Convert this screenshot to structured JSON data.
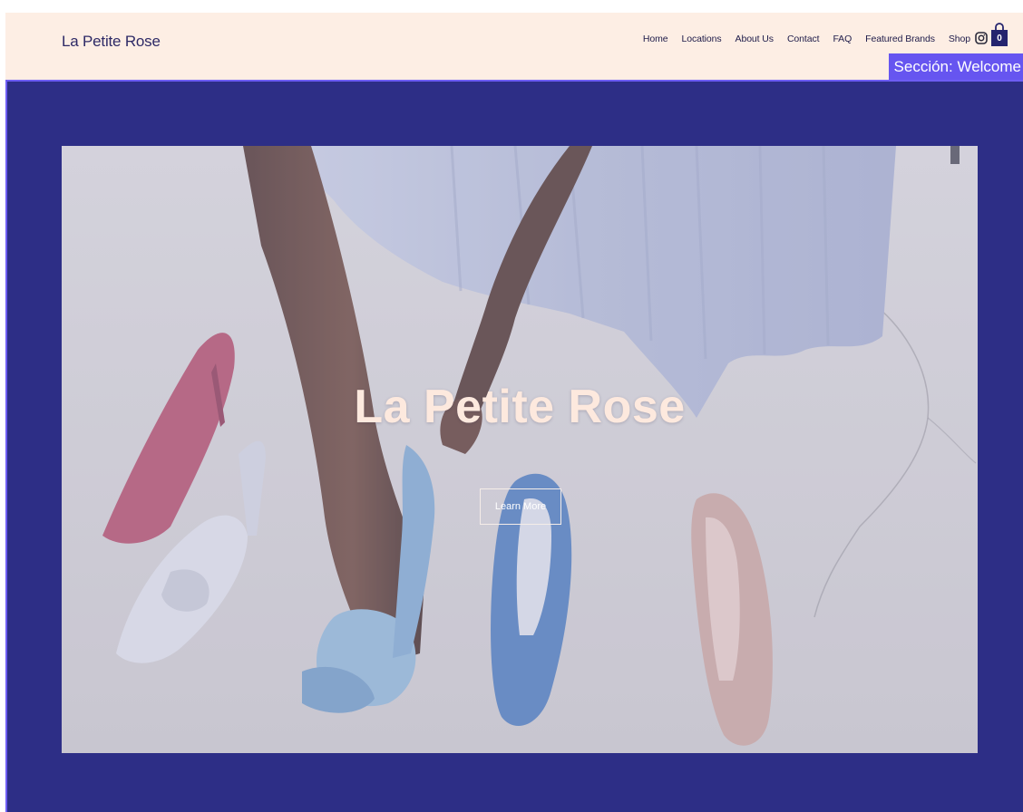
{
  "header": {
    "logo": "La Petite Rose",
    "nav": [
      {
        "label": "Home"
      },
      {
        "label": "Locations"
      },
      {
        "label": "About Us"
      },
      {
        "label": "Contact"
      },
      {
        "label": "FAQ"
      },
      {
        "label": "Featured Brands"
      },
      {
        "label": "Shop"
      }
    ],
    "cart_count": "0",
    "icons": [
      "instagram-icon",
      "shopping-bag-icon"
    ]
  },
  "section_badge": "Sección: Welcome",
  "hero": {
    "title": "La Petite Rose",
    "button_label": "Learn More"
  },
  "colors": {
    "header_bg": "#fdeee4",
    "section_bg": "#2d2e86",
    "badge_bg": "#6655f0",
    "text_dark": "#2e2a66",
    "title_color": "#fde9de"
  }
}
